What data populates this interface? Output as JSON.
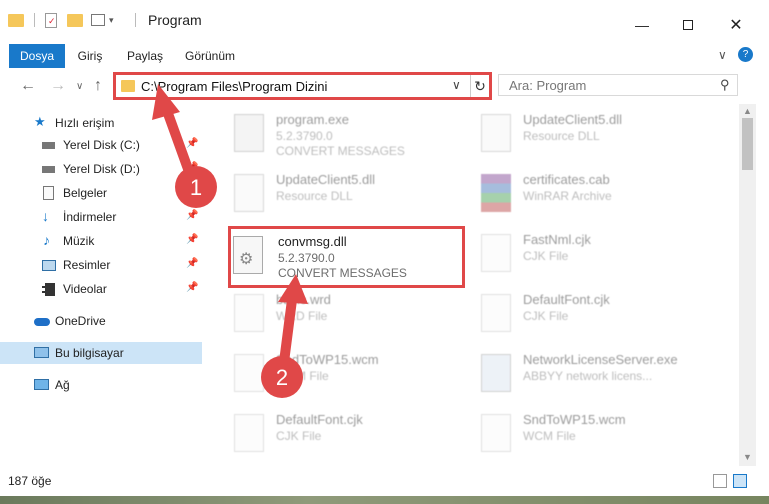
{
  "window": {
    "title": "Program"
  },
  "ribbon": {
    "tabs": [
      "Dosya",
      "Giriş",
      "Paylaş",
      "Görünüm"
    ],
    "active_tab": "Dosya",
    "help_icon": "?"
  },
  "address": {
    "path": "C:\\Program Files\\Program Dizini",
    "search_placeholder": "Ara: Program"
  },
  "sidebar": {
    "items": [
      {
        "label": "Hızlı erişim",
        "icon": "star-icon",
        "pinned": false
      },
      {
        "label": "Yerel Disk (C:)",
        "icon": "drive-icon",
        "pinned": true
      },
      {
        "label": "Yerel Disk (D:)",
        "icon": "drive-icon",
        "pinned": true
      },
      {
        "label": "Belgeler",
        "icon": "document-icon",
        "pinned": true
      },
      {
        "label": "İndirmeler",
        "icon": "download-icon",
        "pinned": true
      },
      {
        "label": "Müzik",
        "icon": "music-icon",
        "pinned": true
      },
      {
        "label": "Resimler",
        "icon": "picture-icon",
        "pinned": true
      },
      {
        "label": "Videolar",
        "icon": "video-icon",
        "pinned": true
      },
      {
        "label": "OneDrive",
        "icon": "cloud-icon",
        "pinned": false
      },
      {
        "label": "Bu bilgisayar",
        "icon": "computer-icon",
        "pinned": false,
        "selected": true
      },
      {
        "label": "Ağ",
        "icon": "network-icon",
        "pinned": false
      }
    ]
  },
  "files": [
    {
      "name": "program.exe",
      "line2": "5.2.3790.0",
      "line3": "CONVERT MESSAGES",
      "icon": "exe-icon",
      "faded": true
    },
    {
      "name": "UpdateClient5.dll",
      "line2": "Resource DLL",
      "line3": "",
      "icon": "dll-icon",
      "faded": true
    },
    {
      "name": "UpdateClient5.dll",
      "line2": "Resource DLL",
      "line3": "",
      "icon": "dll-icon",
      "faded": true
    },
    {
      "name": "certificates.cab",
      "line2": "WinRAR Archive",
      "line3": "",
      "icon": "archive-icon",
      "faded": true
    },
    {
      "name": "convmsg.dll",
      "line2": "5.2.3790.0",
      "line3": "CONVERT MESSAGES",
      "icon": "dll-icon",
      "faded": false,
      "highlight": true
    },
    {
      "name": "FastNml.cjk",
      "line2": "CJK File",
      "line3": "",
      "icon": "file-icon",
      "faded": true
    },
    {
      "name": "basic.wrd",
      "line2": "WRD File",
      "line3": "",
      "icon": "file-icon",
      "faded": true
    },
    {
      "name": "DefaultFont.cjk",
      "line2": "CJK File",
      "line3": "",
      "icon": "file-icon",
      "faded": true
    },
    {
      "name": "SndToWP15.wcm",
      "line2": "WCM File",
      "line3": "",
      "icon": "file-icon",
      "faded": true
    },
    {
      "name": "NetworkLicenseServer.exe",
      "line2": "ABBYY network licens...",
      "line3": "",
      "icon": "exe-icon",
      "faded": true
    },
    {
      "name": "DefaultFont.cjk",
      "line2": "CJK File",
      "line3": "",
      "icon": "file-icon",
      "faded": true
    },
    {
      "name": "SndToWP15.wcm",
      "line2": "WCM File",
      "line3": "",
      "icon": "file-icon",
      "faded": true
    }
  ],
  "status": {
    "item_count": "187 öğe"
  },
  "annotations": {
    "step1": "1",
    "step2": "2",
    "color": "#e04848"
  }
}
